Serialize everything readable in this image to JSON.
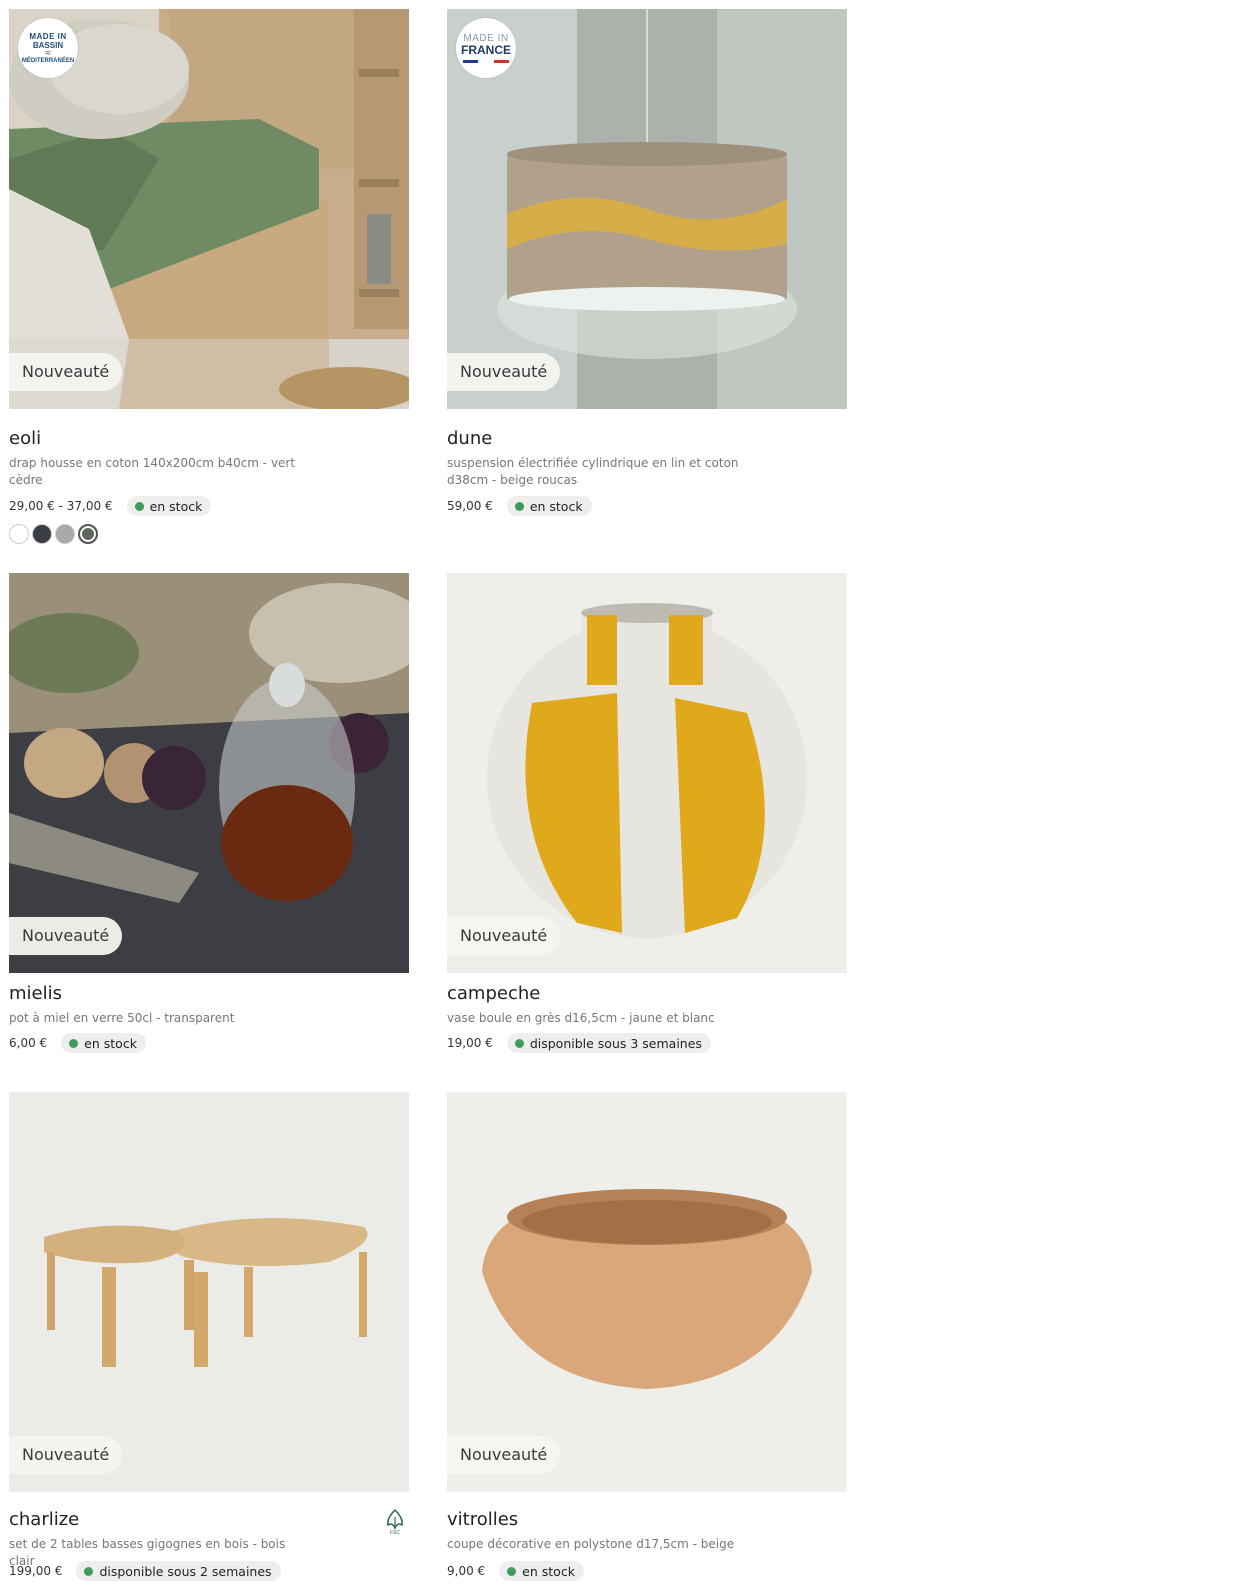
{
  "labels": {
    "new_badge": "Nouveauté"
  },
  "products": [
    {
      "name": "eoli",
      "description": "drap housse en coton 140x200cm b40cm - vert cèdre",
      "price": "29,00 € - 37,00 €",
      "stock": "en stock",
      "badge_text": [
        "MADE IN",
        "BASSIN",
        "MÉDITERRANÉEN"
      ],
      "swatches": [
        "#ffffff",
        "#3a3d45",
        "#a9a9a9",
        "#5e665e"
      ],
      "selected_swatch": 3
    },
    {
      "name": "dune",
      "description": "suspension électrifiée cylindrique en lin et coton d38cm - beige roucas",
      "price": "59,00 €",
      "stock": "en stock",
      "badge_text": [
        "MADE IN",
        "FRANCE"
      ]
    },
    {
      "name": "mielis",
      "description": "pot à miel en verre 50cl - transparent",
      "price": "6,00 €",
      "stock": "en stock"
    },
    {
      "name": "campeche",
      "description": "vase boule en grès d16,5cm - jaune et blanc",
      "price": "19,00 €",
      "stock": "disponible sous 3 semaines"
    },
    {
      "name": "charlize",
      "description": "set de 2 tables basses gigognes en bois - bois clair",
      "price": "199,00 €",
      "stock": "disponible sous 2 semaines",
      "eco_label_icon": "fsc-icon"
    },
    {
      "name": "vitrolles",
      "description": "coupe décorative en polystone d17,5cm - beige",
      "price": "9,00 €",
      "stock": "en stock"
    }
  ],
  "colors": {
    "stock_dot": "#3e9a5d",
    "stock_bg": "#eeefec",
    "flag_blue": "#1f3a8a",
    "flag_red": "#d0342c"
  }
}
